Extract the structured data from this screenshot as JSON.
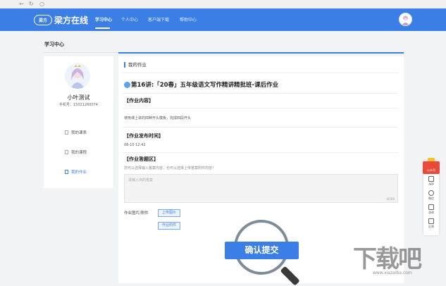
{
  "browser": {
    "back_icon": "back-arrow-icon",
    "refresh_icon": "refresh-icon",
    "stop_icon": "stop-icon"
  },
  "nav": {
    "logo_mark": "梁方",
    "logo_text": "梁方在线",
    "items": [
      "学习中心",
      "个人中心",
      "客户端下载",
      "帮助中心"
    ],
    "active_index": 0,
    "bar_color": "#3b7fe6"
  },
  "page": {
    "section_title": "学习中心"
  },
  "user": {
    "name": "小叶测试",
    "phone": "手机号：15021260074"
  },
  "menu": {
    "items": [
      "我的课表",
      "我的课程",
      "我的作业"
    ],
    "active_index": 2
  },
  "homework": {
    "panel_title": "我的作业",
    "title": "第16讲:「20春」五年级语文写作精讲精批班-课后作业",
    "content_heading": "【作业内容】",
    "content_text": "使用课上讲的四种开头模板，完成四段开头",
    "publish_heading": "【作业发布时间】",
    "publish_time": "06-10 12:42",
    "answer_heading": "【作业答题区】",
    "answer_hint": "您可以选择输入答案内容，也可以选择上传答案附件内容！",
    "answer_placeholder": "请输入你的答案",
    "answer_count": "0/500",
    "attach_label": "作业图片/附件",
    "upload_image": "上传图片",
    "upload_file": "作业附件",
    "confirm": "确认提交"
  },
  "float_bar": {
    "gift_label": "公众号",
    "items": [
      {
        "label": "APP",
        "icon": "phone-icon"
      },
      {
        "label": "微信",
        "icon": "wechat-icon"
      },
      {
        "label": "咨询",
        "icon": "chat-icon"
      },
      {
        "label": "反馈",
        "icon": "feedback-icon"
      }
    ]
  },
  "watermark": {
    "big": "下载吧",
    "small": "www.xiazaiba.com"
  }
}
